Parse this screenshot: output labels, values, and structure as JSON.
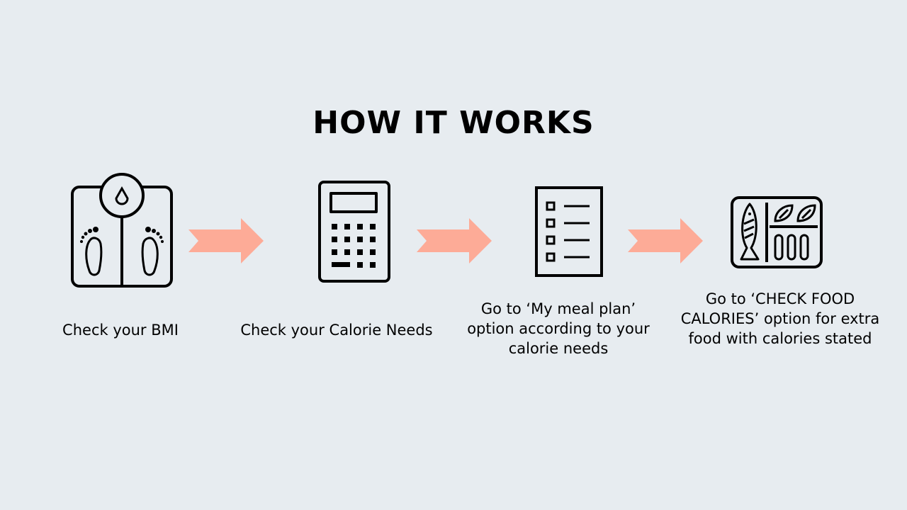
{
  "title": "HOW IT WORKS",
  "colors": {
    "background": "#e7ecf0",
    "arrow": "#fdab97",
    "icon_stroke": "#000000"
  },
  "steps": [
    {
      "icon": "bathroom-scale-icon",
      "label": "Check your BMI"
    },
    {
      "icon": "calculator-icon",
      "label": "Check your Calorie Needs"
    },
    {
      "icon": "checklist-icon",
      "label": "Go to ‘My meal plan’ option according to your calorie needs"
    },
    {
      "icon": "food-tray-icon",
      "label": "Go to ‘CHECK FOOD CALORIES’ option for extra food with calories stated"
    }
  ]
}
